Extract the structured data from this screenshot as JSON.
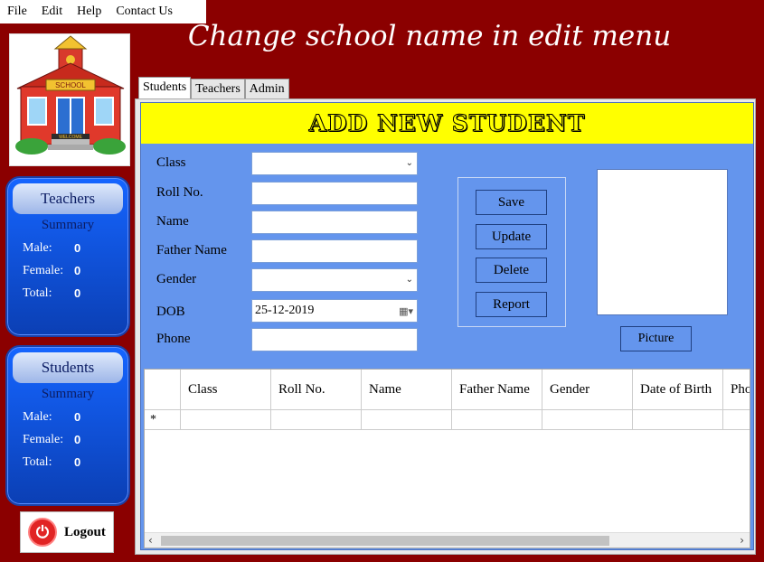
{
  "menu": [
    "File",
    "Edit",
    "Help",
    "Contact Us"
  ],
  "app_title": "Change school name in edit menu",
  "logo": {
    "sign_text": "SCHOOL",
    "mat_text": "WELCOME"
  },
  "teachers_summary": {
    "title": "Teachers",
    "subtitle": "Summary",
    "rows": [
      {
        "label": "Male:",
        "value": "0"
      },
      {
        "label": "Female:",
        "value": "0"
      },
      {
        "label": "Total:",
        "value": "0"
      }
    ]
  },
  "students_summary": {
    "title": "Students",
    "subtitle": "Summary",
    "rows": [
      {
        "label": "Male:",
        "value": "0"
      },
      {
        "label": "Female:",
        "value": "0"
      },
      {
        "label": "Total:",
        "value": "0"
      }
    ]
  },
  "logout_label": "Logout",
  "tabs": [
    "Students",
    "Teachers",
    "Admin"
  ],
  "active_tab": "Students",
  "banner": "ADD NEW STUDENT",
  "form": {
    "class_label": "Class",
    "class_value": "",
    "roll_label": "Roll No.",
    "roll_value": "",
    "name_label": "Name",
    "name_value": "",
    "father_label": "Father Name",
    "father_value": "",
    "gender_label": "Gender",
    "gender_value": "",
    "dob_label": "DOB",
    "dob_value": "25-12-2019",
    "phone_label": "Phone",
    "phone_value": ""
  },
  "buttons": {
    "save": "Save",
    "update": "Update",
    "delete": "Delete",
    "report": "Report",
    "picture": "Picture"
  },
  "grid": {
    "columns": [
      "Class",
      "Roll No.",
      "Name",
      "Father Name",
      "Gender",
      "Date of Birth",
      "Phone"
    ],
    "new_row_marker": "*"
  },
  "colors": {
    "background": "#8B0000",
    "panel": "#6495ED",
    "banner": "#FFFF00",
    "summary": "#1565FF"
  }
}
